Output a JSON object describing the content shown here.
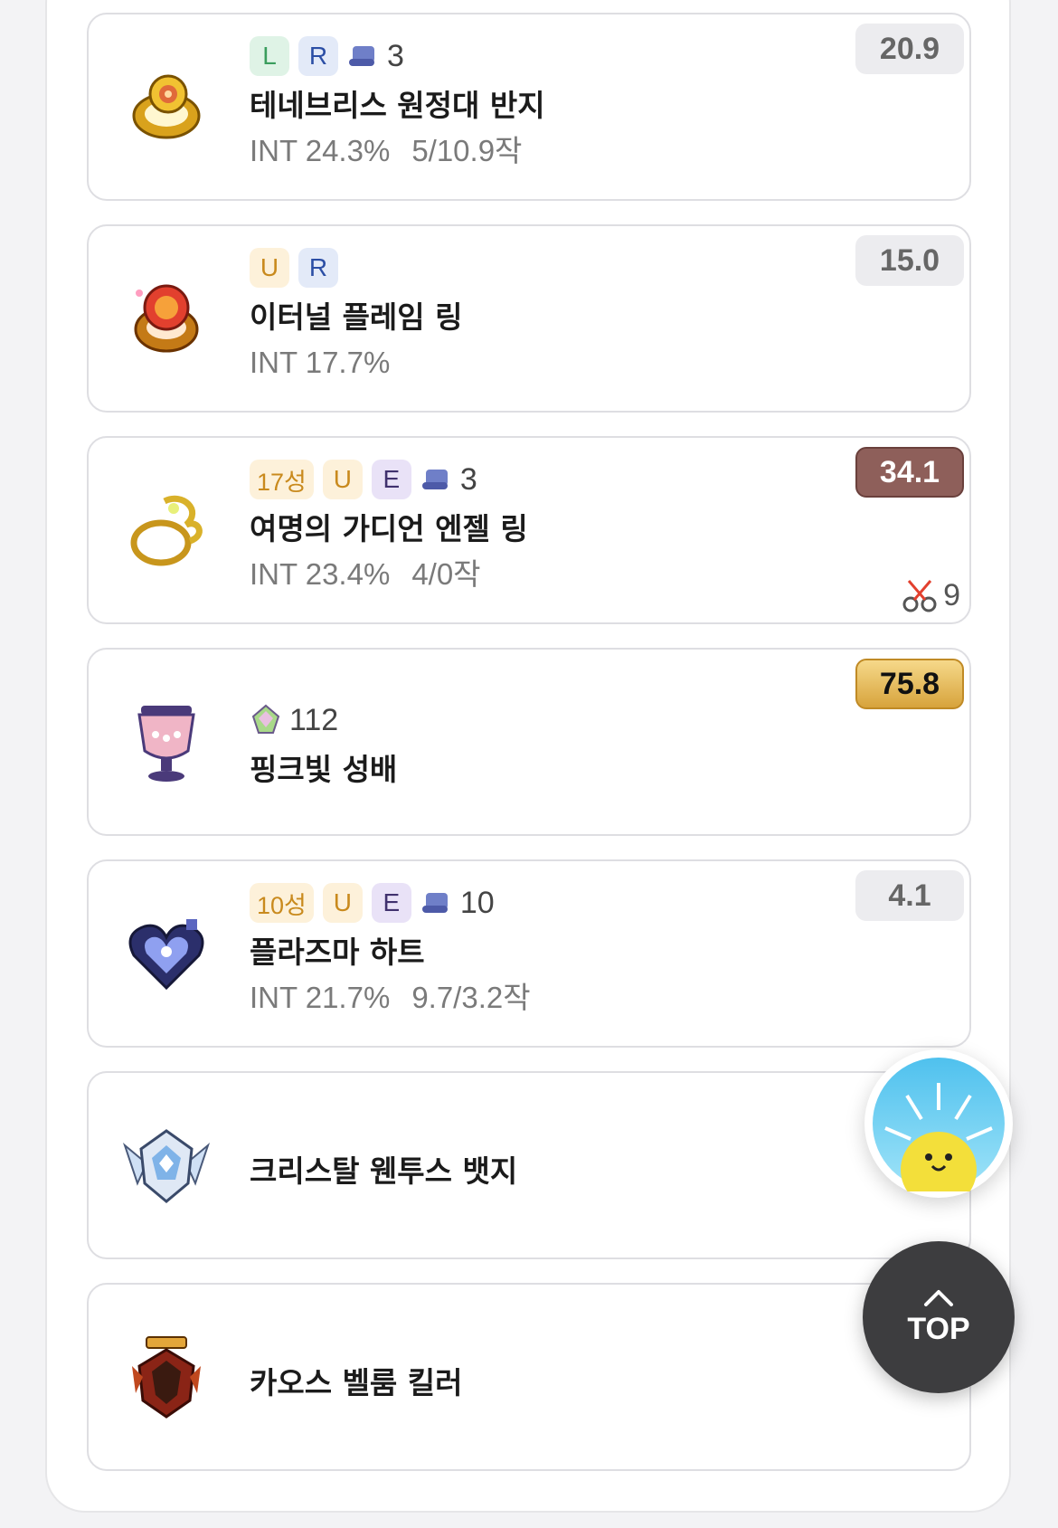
{
  "items": [
    {
      "star": "",
      "tags": [
        "L",
        "R"
      ],
      "scroll_count": "3",
      "gem_count": "",
      "name": "테네브리스 원정대 반지",
      "stat": "INT 24.3%",
      "upgrade": "5/10.9작",
      "score": "20.9",
      "score_style": "gray",
      "cut_count": "",
      "icon": "ring-gold-icon"
    },
    {
      "star": "",
      "tags": [
        "U",
        "R"
      ],
      "scroll_count": "",
      "gem_count": "",
      "name": "이터널 플레임 링",
      "stat": "INT 17.7%",
      "upgrade": "",
      "score": "15.0",
      "score_style": "gray",
      "cut_count": "",
      "icon": "flame-ring-icon"
    },
    {
      "star": "17성",
      "tags": [
        "U",
        "E"
      ],
      "scroll_count": "3",
      "gem_count": "",
      "name": "여명의 가디언 엔젤 링",
      "stat": "INT 23.4%",
      "upgrade": "4/0작",
      "score": "34.1",
      "score_style": "brown",
      "cut_count": "9",
      "icon": "angel-ring-icon"
    },
    {
      "star": "",
      "tags": [],
      "scroll_count": "",
      "gem_count": "112",
      "name": "핑크빛 성배",
      "stat": "",
      "upgrade": "",
      "score": "75.8",
      "score_style": "gold",
      "cut_count": "",
      "icon": "pink-chalice-icon"
    },
    {
      "star": "10성",
      "tags": [
        "U",
        "E"
      ],
      "scroll_count": "10",
      "gem_count": "",
      "name": "플라즈마 하트",
      "stat": "INT 21.7%",
      "upgrade": "9.7/3.2작",
      "score": "4.1",
      "score_style": "gray",
      "cut_count": "",
      "icon": "plasma-heart-icon"
    },
    {
      "star": "",
      "tags": [],
      "scroll_count": "",
      "gem_count": "",
      "name": "크리스탈 웬투스 뱃지",
      "stat": "",
      "upgrade": "",
      "score": "",
      "score_style": "",
      "cut_count": "",
      "icon": "crystal-badge-icon"
    },
    {
      "star": "",
      "tags": [],
      "scroll_count": "",
      "gem_count": "",
      "name": "카오스 벨룸 킬러",
      "stat": "",
      "upgrade": "",
      "score": "",
      "score_style": "",
      "cut_count": "",
      "icon": "medal-icon"
    }
  ],
  "floating": {
    "helper_icon": "sun-character-icon",
    "top_label": "TOP",
    "top_icon": "chevron-up-icon"
  }
}
